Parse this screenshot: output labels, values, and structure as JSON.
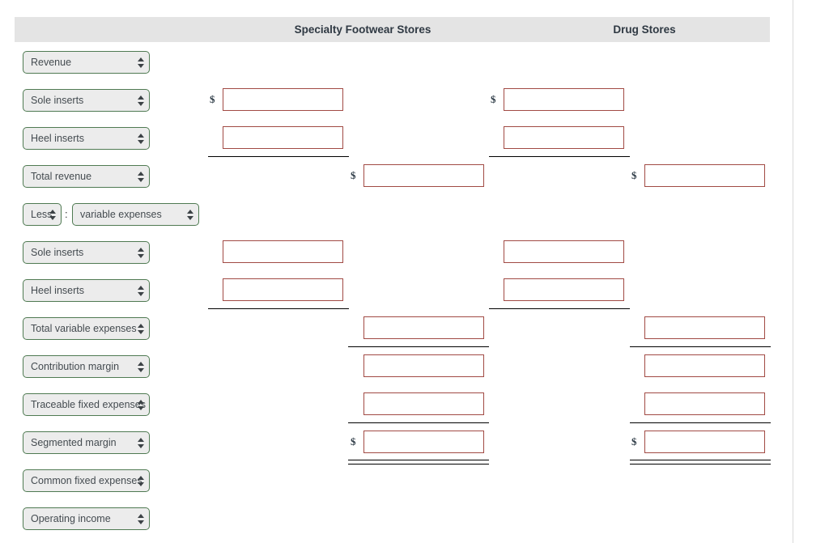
{
  "header": {
    "columns": [
      {
        "label": "Specialty Footwear Stores"
      },
      {
        "label": "Drug Stores"
      }
    ]
  },
  "currency_symbol": "$",
  "colon_separator": ":",
  "rows": [
    {
      "id": "revenue",
      "label": "Revenue"
    },
    {
      "id": "sole-inserts-rev",
      "label": "Sole inserts"
    },
    {
      "id": "heel-inserts-rev",
      "label": "Heel inserts"
    },
    {
      "id": "total-revenue",
      "label": "Total revenue"
    },
    {
      "id": "less-variable-expenses",
      "label": "Less",
      "label2": "variable expenses"
    },
    {
      "id": "sole-inserts-var",
      "label": "Sole inserts"
    },
    {
      "id": "heel-inserts-var",
      "label": "Heel inserts"
    },
    {
      "id": "total-variable-expenses",
      "label": "Total variable expenses"
    },
    {
      "id": "contribution-margin",
      "label": "Contribution margin"
    },
    {
      "id": "traceable-fixed-expenses",
      "label": "Traceable fixed expenses"
    },
    {
      "id": "segmented-margin",
      "label": "Segmented margin"
    },
    {
      "id": "common-fixed-expenses",
      "label": "Common fixed expenses"
    },
    {
      "id": "operating-income",
      "label": "Operating income"
    }
  ],
  "inputs": {
    "sole_inserts_rev_sfs": "",
    "sole_inserts_rev_ds": "",
    "heel_inserts_rev_sfs": "",
    "heel_inserts_rev_ds": "",
    "total_revenue_sfs": "",
    "total_revenue_ds": "",
    "sole_inserts_var_sfs": "",
    "sole_inserts_var_ds": "",
    "heel_inserts_var_sfs": "",
    "heel_inserts_var_ds": "",
    "total_variable_expenses_sfs": "",
    "total_variable_expenses_ds": "",
    "contribution_margin_sfs": "",
    "contribution_margin_ds": "",
    "traceable_fixed_expenses_sfs": "",
    "traceable_fixed_expenses_ds": "",
    "segmented_margin_sfs": "",
    "segmented_margin_ds": ""
  },
  "colors": {
    "select_border": "#4f7a52",
    "select_background": "#ececec",
    "input_border": "#a14a44",
    "header_background": "#e4e4e4",
    "header_text": "#2f3943"
  }
}
